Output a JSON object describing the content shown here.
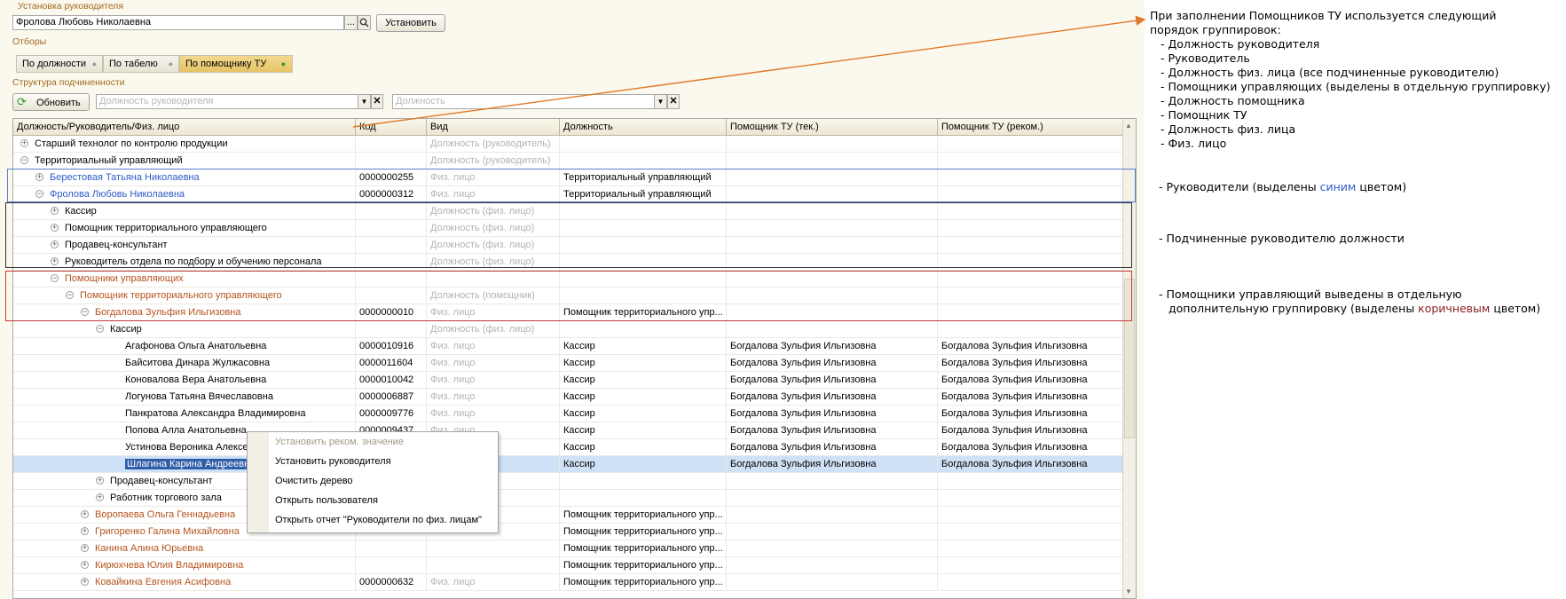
{
  "form": {
    "manager_section_title": "Установка руководителя",
    "manager_value": "Фролова Любовь Николаевна",
    "set_button": "Установить",
    "filters_title": "Отборы",
    "filters": [
      "По должности",
      "По табелю",
      "По помощнику ТУ"
    ],
    "active_filter": "По помощнику ТУ",
    "structure_title": "Структура подчиненности",
    "refresh_button": "Обновить",
    "position_manager_placeholder": "Должность руководителя",
    "position_placeholder": "Должность"
  },
  "table": {
    "columns": [
      "Должность/Руководитель/Физ. лицо",
      "Код",
      "Вид",
      "Должность",
      "Помощник ТУ (тек.)",
      "Помощник ТУ (реком.)"
    ],
    "rows": [
      {
        "name": "Старший технолог по контролю продукции",
        "code": "",
        "kind": "Должность (руководитель)",
        "position": "",
        "cur": "",
        "rec": "",
        "style": "normal",
        "level": 0,
        "toggle": "+"
      },
      {
        "name": "Территориальный управляющий",
        "code": "",
        "kind": "Должность (руководитель)",
        "position": "",
        "cur": "",
        "rec": "",
        "style": "normal",
        "level": 0,
        "toggle": "-"
      },
      {
        "name": "Берестовая Татьяна Николаевна",
        "code": "0000000255",
        "kind": "Физ. лицо",
        "position": "Территориальный управляющий",
        "cur": "",
        "rec": "",
        "style": "blue",
        "level": 1,
        "toggle": "+"
      },
      {
        "name": "Фролова Любовь Николаевна",
        "code": "0000000312",
        "kind": "Физ. лицо",
        "position": "Территориальный управляющий",
        "cur": "",
        "rec": "",
        "style": "blue",
        "level": 1,
        "toggle": "-"
      },
      {
        "name": "Кассир",
        "code": "",
        "kind": "Должность (физ. лицо)",
        "position": "",
        "cur": "",
        "rec": "",
        "style": "normal",
        "level": 2,
        "toggle": "+"
      },
      {
        "name": "Помощник территориального управляющего",
        "code": "",
        "kind": "Должность (физ. лицо)",
        "position": "",
        "cur": "",
        "rec": "",
        "style": "normal",
        "level": 2,
        "toggle": "+"
      },
      {
        "name": "Продавец-консультант",
        "code": "",
        "kind": "Должность (физ. лицо)",
        "position": "",
        "cur": "",
        "rec": "",
        "style": "normal",
        "level": 2,
        "toggle": "+"
      },
      {
        "name": "Руководитель отдела по подбору и обучению персонала",
        "code": "",
        "kind": "Должность (физ. лицо)",
        "position": "",
        "cur": "",
        "rec": "",
        "style": "normal",
        "level": 2,
        "toggle": "+"
      },
      {
        "name": "Помощники управляющих",
        "code": "",
        "kind": "",
        "position": "",
        "cur": "",
        "rec": "",
        "style": "brown",
        "level": 2,
        "toggle": "-"
      },
      {
        "name": "Помощник территориального управляющего",
        "code": "",
        "kind": "Должность (помощник)",
        "position": "",
        "cur": "",
        "rec": "",
        "style": "brown",
        "level": 3,
        "toggle": "-"
      },
      {
        "name": "Богдалова Зульфия Ильгизовна",
        "code": "0000000010",
        "kind": "Физ. лицо",
        "position": "Помощник территориального упр...",
        "cur": "",
        "rec": "",
        "style": "brown",
        "level": 4,
        "toggle": "-"
      },
      {
        "name": "Кассир",
        "code": "",
        "kind": "Должность (физ. лицо)",
        "position": "",
        "cur": "",
        "rec": "",
        "style": "normal",
        "level": 5,
        "toggle": "-"
      },
      {
        "name": "Агафонова Ольга Анатольевна",
        "code": "0000010916",
        "kind": "Физ. лицо",
        "position": "Кассир",
        "cur": "Богдалова Зульфия Ильгизовна",
        "rec": "Богдалова Зульфия Ильгизовна",
        "style": "normal",
        "level": 6,
        "toggle": ""
      },
      {
        "name": "Байситова Динара Жулжасовна",
        "code": "0000011604",
        "kind": "Физ. лицо",
        "position": "Кассир",
        "cur": "Богдалова Зульфия Ильгизовна",
        "rec": "Богдалова Зульфия Ильгизовна",
        "style": "normal",
        "level": 6,
        "toggle": ""
      },
      {
        "name": "Коновалова Вера Анатольевна",
        "code": "0000010042",
        "kind": "Физ. лицо",
        "position": "Кассир",
        "cur": "Богдалова Зульфия Ильгизовна",
        "rec": "Богдалова Зульфия Ильгизовна",
        "style": "normal",
        "level": 6,
        "toggle": ""
      },
      {
        "name": "Логунова Татьяна Вячеславовна",
        "code": "0000006887",
        "kind": "Физ. лицо",
        "position": "Кассир",
        "cur": "Богдалова Зульфия Ильгизовна",
        "rec": "Богдалова Зульфия Ильгизовна",
        "style": "normal",
        "level": 6,
        "toggle": ""
      },
      {
        "name": "Панкратова Александра Владимировна",
        "code": "0000009776",
        "kind": "Физ. лицо",
        "position": "Кассир",
        "cur": "Богдалова Зульфия Ильгизовна",
        "rec": "Богдалова Зульфия Ильгизовна",
        "style": "normal",
        "level": 6,
        "toggle": ""
      },
      {
        "name": "Попова Алла Анатольевна",
        "code": "0000009437",
        "kind": "Физ. лицо",
        "position": "Кассир",
        "cur": "Богдалова Зульфия Ильгизовна",
        "rec": "Богдалова Зульфия Ильгизовна",
        "style": "normal",
        "level": 6,
        "toggle": ""
      },
      {
        "name": "Устинова Вероника Алексеевна",
        "code": "0000009113",
        "kind": "Физ. лицо",
        "position": "Кассир",
        "cur": "Богдалова Зульфия Ильгизовна",
        "rec": "Богдалова Зульфия Ильгизовна",
        "style": "normal",
        "level": 6,
        "toggle": ""
      },
      {
        "name": "Шлагина Карина Андреевна",
        "code": "",
        "kind": "",
        "position": "Кассир",
        "cur": "Богдалова Зульфия Ильгизовна",
        "rec": "Богдалова Зульфия Ильгизовна",
        "style": "selected",
        "level": 6,
        "toggle": ""
      },
      {
        "name": "Продавец-консультант",
        "code": "",
        "kind": "",
        "position": "",
        "cur": "",
        "rec": "",
        "style": "normal",
        "level": 5,
        "toggle": "+"
      },
      {
        "name": "Работник торгового зала",
        "code": "",
        "kind": "",
        "position": "",
        "cur": "",
        "rec": "",
        "style": "normal",
        "level": 5,
        "toggle": "+"
      },
      {
        "name": "Воропаева Ольга Геннадьевна",
        "code": "",
        "kind": "",
        "position": "Помощник территориального упр...",
        "cur": "",
        "rec": "",
        "style": "brown",
        "level": 4,
        "toggle": "+"
      },
      {
        "name": "Григоренко Галина Михайловна",
        "code": "",
        "kind": "",
        "position": "Помощник территориального упр...",
        "cur": "",
        "rec": "",
        "style": "brown",
        "level": 4,
        "toggle": "+"
      },
      {
        "name": "Канина Алина Юрьевна",
        "code": "",
        "kind": "",
        "position": "Помощник территориального упр...",
        "cur": "",
        "rec": "",
        "style": "brown",
        "level": 4,
        "toggle": "+"
      },
      {
        "name": "Кирюхчева Юлия Владимировна",
        "code": "",
        "kind": "",
        "position": "Помощник территориального упр...",
        "cur": "",
        "rec": "",
        "style": "brown",
        "level": 4,
        "toggle": "+"
      },
      {
        "name": "Ковайкина Евгения Асифовна",
        "code": "0000000632",
        "kind": "Физ. лицо",
        "position": "Помощник территориального упр...",
        "cur": "",
        "rec": "",
        "style": "brown",
        "level": 4,
        "toggle": "+"
      }
    ]
  },
  "context_menu": {
    "items": [
      "Установить реком. значение",
      "Установить руководителя",
      "Очистить дерево",
      "Открыть пользователя",
      "Открыть отчет \"Руководители по физ. лицам\""
    ],
    "disabled_index": 0
  },
  "annotations": {
    "grouping_title_line1": "При заполнении Помощников ТУ используется следующий",
    "grouping_title_line2": "порядок группировок:",
    "grouping_items": [
      "- Должность руководителя",
      "- Руководитель",
      "- Должность физ. лица (все подчиненные руководителю)",
      "- Помощники управляющих (выделены в отдельную группировку)",
      "- Должность помощника",
      "- Помощник ТУ",
      "- Должность физ. лица",
      "- Физ. лицо"
    ],
    "managers_pre": "- Руководители (выделены ",
    "managers_word": "синим",
    "managers_post": " цветом)",
    "subordinates": "- Подчиненные руководителю должности",
    "assistants_line1": "- Помощники управляющий выведены в отдельную",
    "assistants_line2_pre": "дополнительную группировку (выделены ",
    "assistants_word": "коричневым",
    "assistants_post": " цветом)"
  },
  "colors": {
    "manager": "#2c5cc5",
    "assistant": "#b6531c",
    "selected": "#cfe1f7",
    "arrow": "#e07a2a"
  }
}
